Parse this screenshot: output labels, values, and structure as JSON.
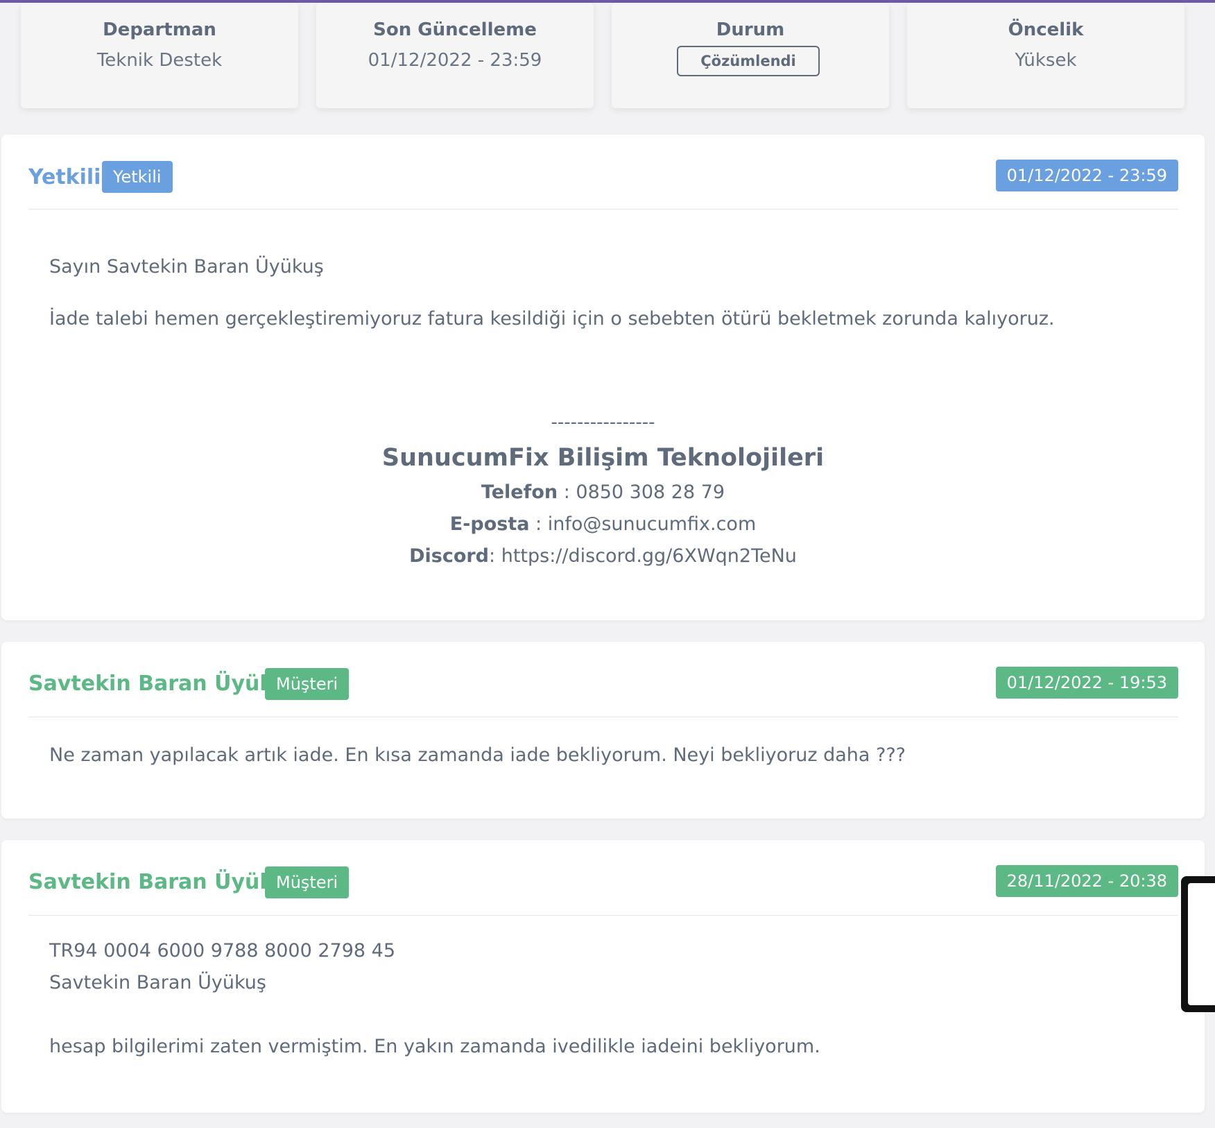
{
  "info_cards": [
    {
      "label": "Departman",
      "value": "Teknik Destek"
    },
    {
      "label": "Son Güncelleme",
      "value": "01/12/2022 - 23:59"
    },
    {
      "label": "Durum",
      "value": "Çözümlendi"
    },
    {
      "label": "Öncelik",
      "value": "Yüksek"
    }
  ],
  "messages": [
    {
      "author": "Yetkili",
      "role": "Yetkili",
      "date": "01/12/2022 - 23:59",
      "lines": [
        "Sayın Savtekin Baran Üyükuş",
        "İade talebi hemen gerçekleştiremiyoruz fatura kesildiği için o sebebten ötürü bekletmek zorunda kalıyoruz."
      ],
      "signature": {
        "separator": "----------------",
        "company": "SunucumFix Bilişim Teknolojileri",
        "phone_label": "Telefon",
        "phone_sep": " : ",
        "phone": "0850 308 28 79",
        "email_label": "E-posta",
        "email_sep": " : ",
        "email": "info@sunucumfix.com",
        "discord_label": "Discord",
        "discord_sep": ": ",
        "discord": "https://discord.gg/6XWqn2TeNu"
      }
    },
    {
      "author": "Savtekin Baran Üyükuş",
      "role": "Müşteri",
      "date": "01/12/2022 - 19:53",
      "lines": [
        "Ne zaman yapılacak artık iade. En kısa zamanda iade bekliyorum. Neyi bekliyoruz daha ???"
      ]
    },
    {
      "author": "Savtekin Baran Üyükuş",
      "role": "Müşteri",
      "date": "28/11/2022 - 20:38",
      "lines": [
        "TR94 0004 6000 9788 8000 2798 45",
        "Savtekin Baran Üyükuş",
        "hesap bilgilerimi zaten vermiştim. En yakın zamanda ivedilikle iadeini bekliyorum."
      ]
    }
  ],
  "colors": {
    "staff": "#6a9fe0",
    "customer": "#5cb885",
    "text": "#5f6b7a",
    "top_bar": "#6d5aa8"
  }
}
